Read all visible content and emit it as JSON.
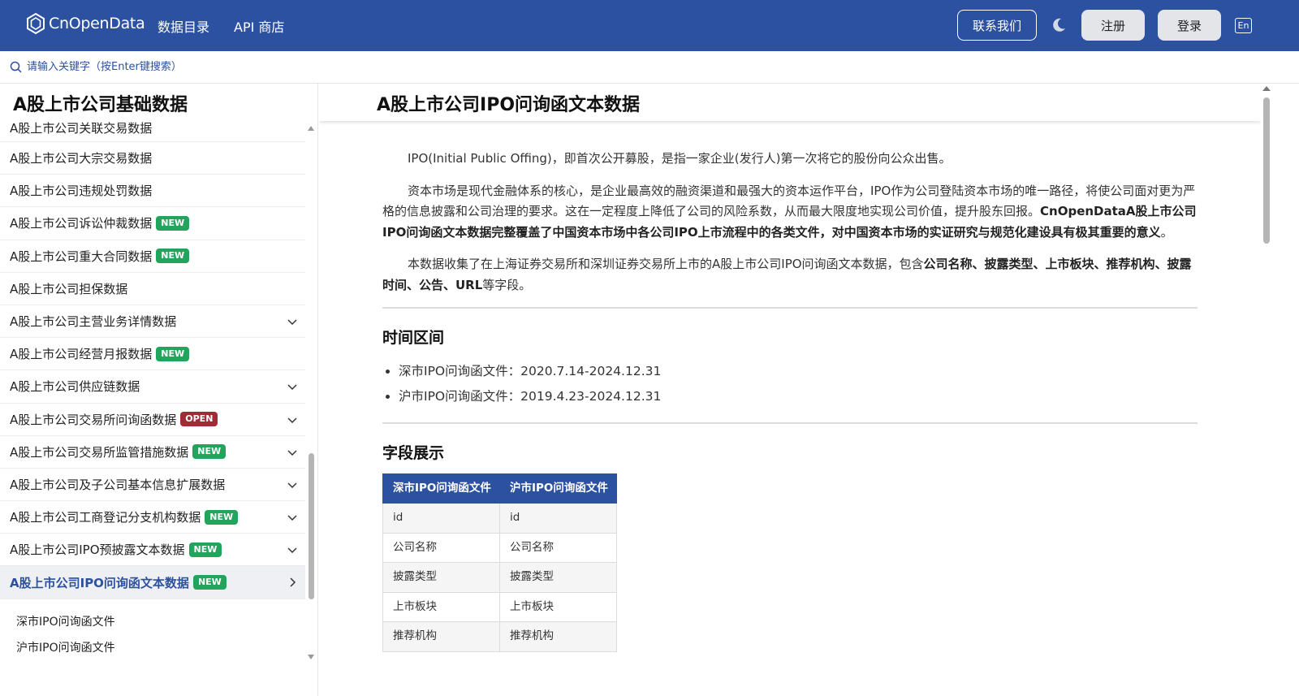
{
  "header": {
    "logo_text": "CnOpenData",
    "nav": [
      "数据目录",
      "API 商店"
    ],
    "contact_label": "联系我们",
    "register_label": "注册",
    "login_label": "登录",
    "lang_label": "En",
    "brand_color": "#2c51a0"
  },
  "search": {
    "placeholder": "请输入关键字（按Enter键搜索）"
  },
  "sidebar": {
    "title": "A股上市公司基础数据",
    "items": [
      {
        "label": "A股上市公司关联交易数据",
        "badge": "",
        "chevron": false,
        "active": false
      },
      {
        "label": "A股上市公司大宗交易数据",
        "badge": "",
        "chevron": false,
        "active": false
      },
      {
        "label": "A股上市公司违规处罚数据",
        "badge": "",
        "chevron": false,
        "active": false
      },
      {
        "label": "A股上市公司诉讼仲裁数据",
        "badge": "NEW",
        "chevron": false,
        "active": false
      },
      {
        "label": "A股上市公司重大合同数据",
        "badge": "NEW",
        "chevron": false,
        "active": false
      },
      {
        "label": "A股上市公司担保数据",
        "badge": "",
        "chevron": false,
        "active": false
      },
      {
        "label": "A股上市公司主营业务详情数据",
        "badge": "",
        "chevron": true,
        "active": false
      },
      {
        "label": "A股上市公司经营月报数据",
        "badge": "NEW",
        "chevron": false,
        "active": false
      },
      {
        "label": "A股上市公司供应链数据",
        "badge": "",
        "chevron": true,
        "active": false
      },
      {
        "label": "A股上市公司交易所问询函数据",
        "badge": "OPEN",
        "chevron": true,
        "active": false
      },
      {
        "label": "A股上市公司交易所监管措施数据",
        "badge": "NEW",
        "chevron": true,
        "active": false
      },
      {
        "label": "A股上市公司及子公司基本信息扩展数据",
        "badge": "",
        "chevron": true,
        "active": false
      },
      {
        "label": "A股上市公司工商登记分支机构数据",
        "badge": "NEW",
        "chevron": true,
        "active": false
      },
      {
        "label": "A股上市公司IPO预披露文本数据",
        "badge": "NEW",
        "chevron": true,
        "active": false
      },
      {
        "label": "A股上市公司IPO问询函文本数据",
        "badge": "NEW",
        "chevron": "right",
        "active": true
      }
    ],
    "sub_items": [
      "深市IPO问询函文件",
      "沪市IPO问询函文件"
    ]
  },
  "main": {
    "title": "A股上市公司IPO问询函文本数据",
    "p1": "IPO(Initial Public Offing)，即首次公开募股，是指一家企业(发行人)第一次将它的股份向公众出售。",
    "p2_plain": "资本市场是现代金融体系的核心，是企业最高效的融资渠道和最强大的资本运作平台，IPO作为公司登陆资本市场的唯一路径，将使公司面对更为严格的信息披露和公司治理的要求。这在一定程度上降低了公司的风险系数，从而最大限度地实现公司价值，提升股东回报。",
    "p2_bold": "CnOpenDataA股上市公司IPO问询函文本数据完整覆盖了中国资本市场中各公司IPO上市流程中的各类文件，对中国资本市场的实证研究与规范化建设具有极其重要的意义",
    "p2_end": "。",
    "p3_plain": "本数据收集了在上海证券交易所和深圳证券交易所上市的A股上市公司IPO问询函文本数据，包含",
    "p3_bold": "公司名称、披露类型、上市板块、推荐机构、披露时间、公告、URL",
    "p3_end": "等字段。",
    "section_time": "时间区间",
    "time_items": [
      "深市IPO问询函文件：2020.7.14-2024.12.31",
      "沪市IPO问询函文件：2019.4.23-2024.12.31"
    ],
    "section_fields": "字段展示",
    "table": {
      "headers": [
        "深市IPO问询函文件",
        "沪市IPO问询函文件"
      ],
      "rows": [
        [
          "id",
          "id"
        ],
        [
          "公司名称",
          "公司名称"
        ],
        [
          "披露类型",
          "披露类型"
        ],
        [
          "上市板块",
          "上市板块"
        ],
        [
          "推荐机构",
          "推荐机构"
        ]
      ]
    }
  }
}
